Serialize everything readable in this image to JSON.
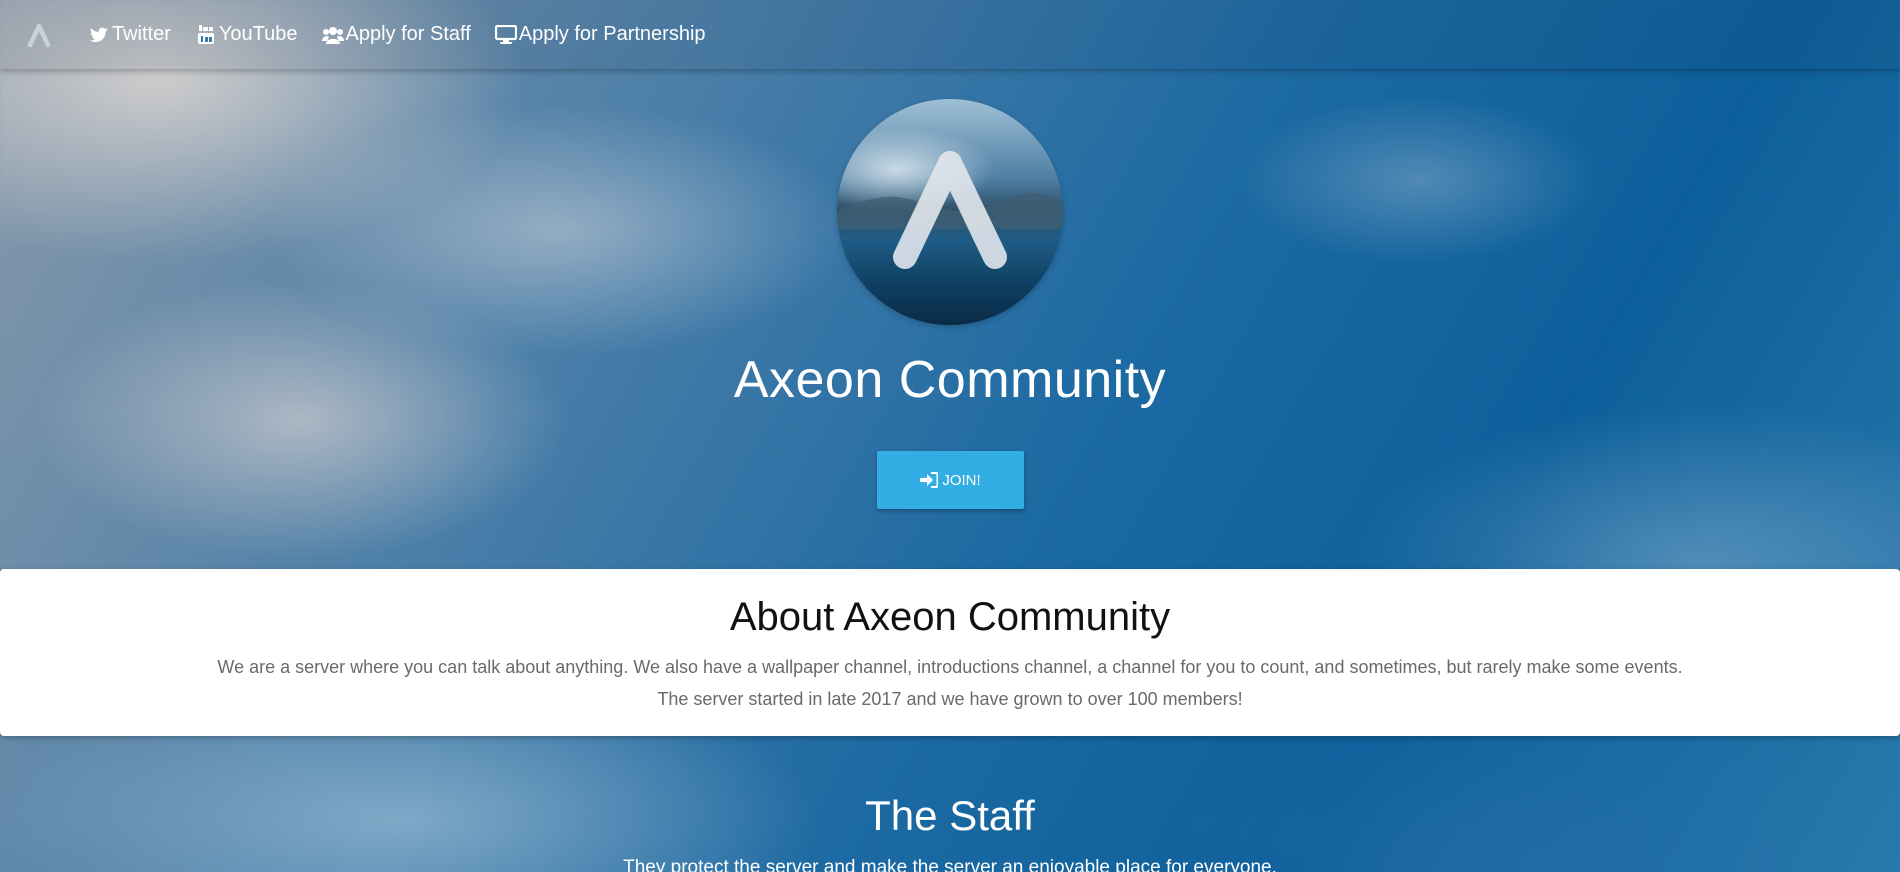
{
  "nav": {
    "brand_icon": "axeon-logo-icon",
    "items": [
      {
        "label": "Twitter",
        "icon": "twitter-icon"
      },
      {
        "label": "YouTube",
        "icon": "youtube-icon"
      },
      {
        "label": "Apply for Staff",
        "icon": "users-icon"
      },
      {
        "label": "Apply for Partnership",
        "icon": "desktop-icon"
      }
    ]
  },
  "hero": {
    "avatar_icon": "axeon-logo-icon",
    "title": "Axeon Community",
    "join_label": "JOIN!",
    "join_icon": "sign-in-icon",
    "join_color": "#33aee4"
  },
  "about": {
    "title": "About Axeon Community",
    "line1": "We are a server where you can talk about anything. We also have a wallpaper channel, introductions channel, a channel for you to count, and sometimes, but rarely make some events.",
    "line2": "The server started in late 2017 and we have grown to over 100 members!"
  },
  "staff": {
    "title": "The Staff",
    "subtitle": "They protect the server and make the server an enjoyable place for everyone."
  }
}
